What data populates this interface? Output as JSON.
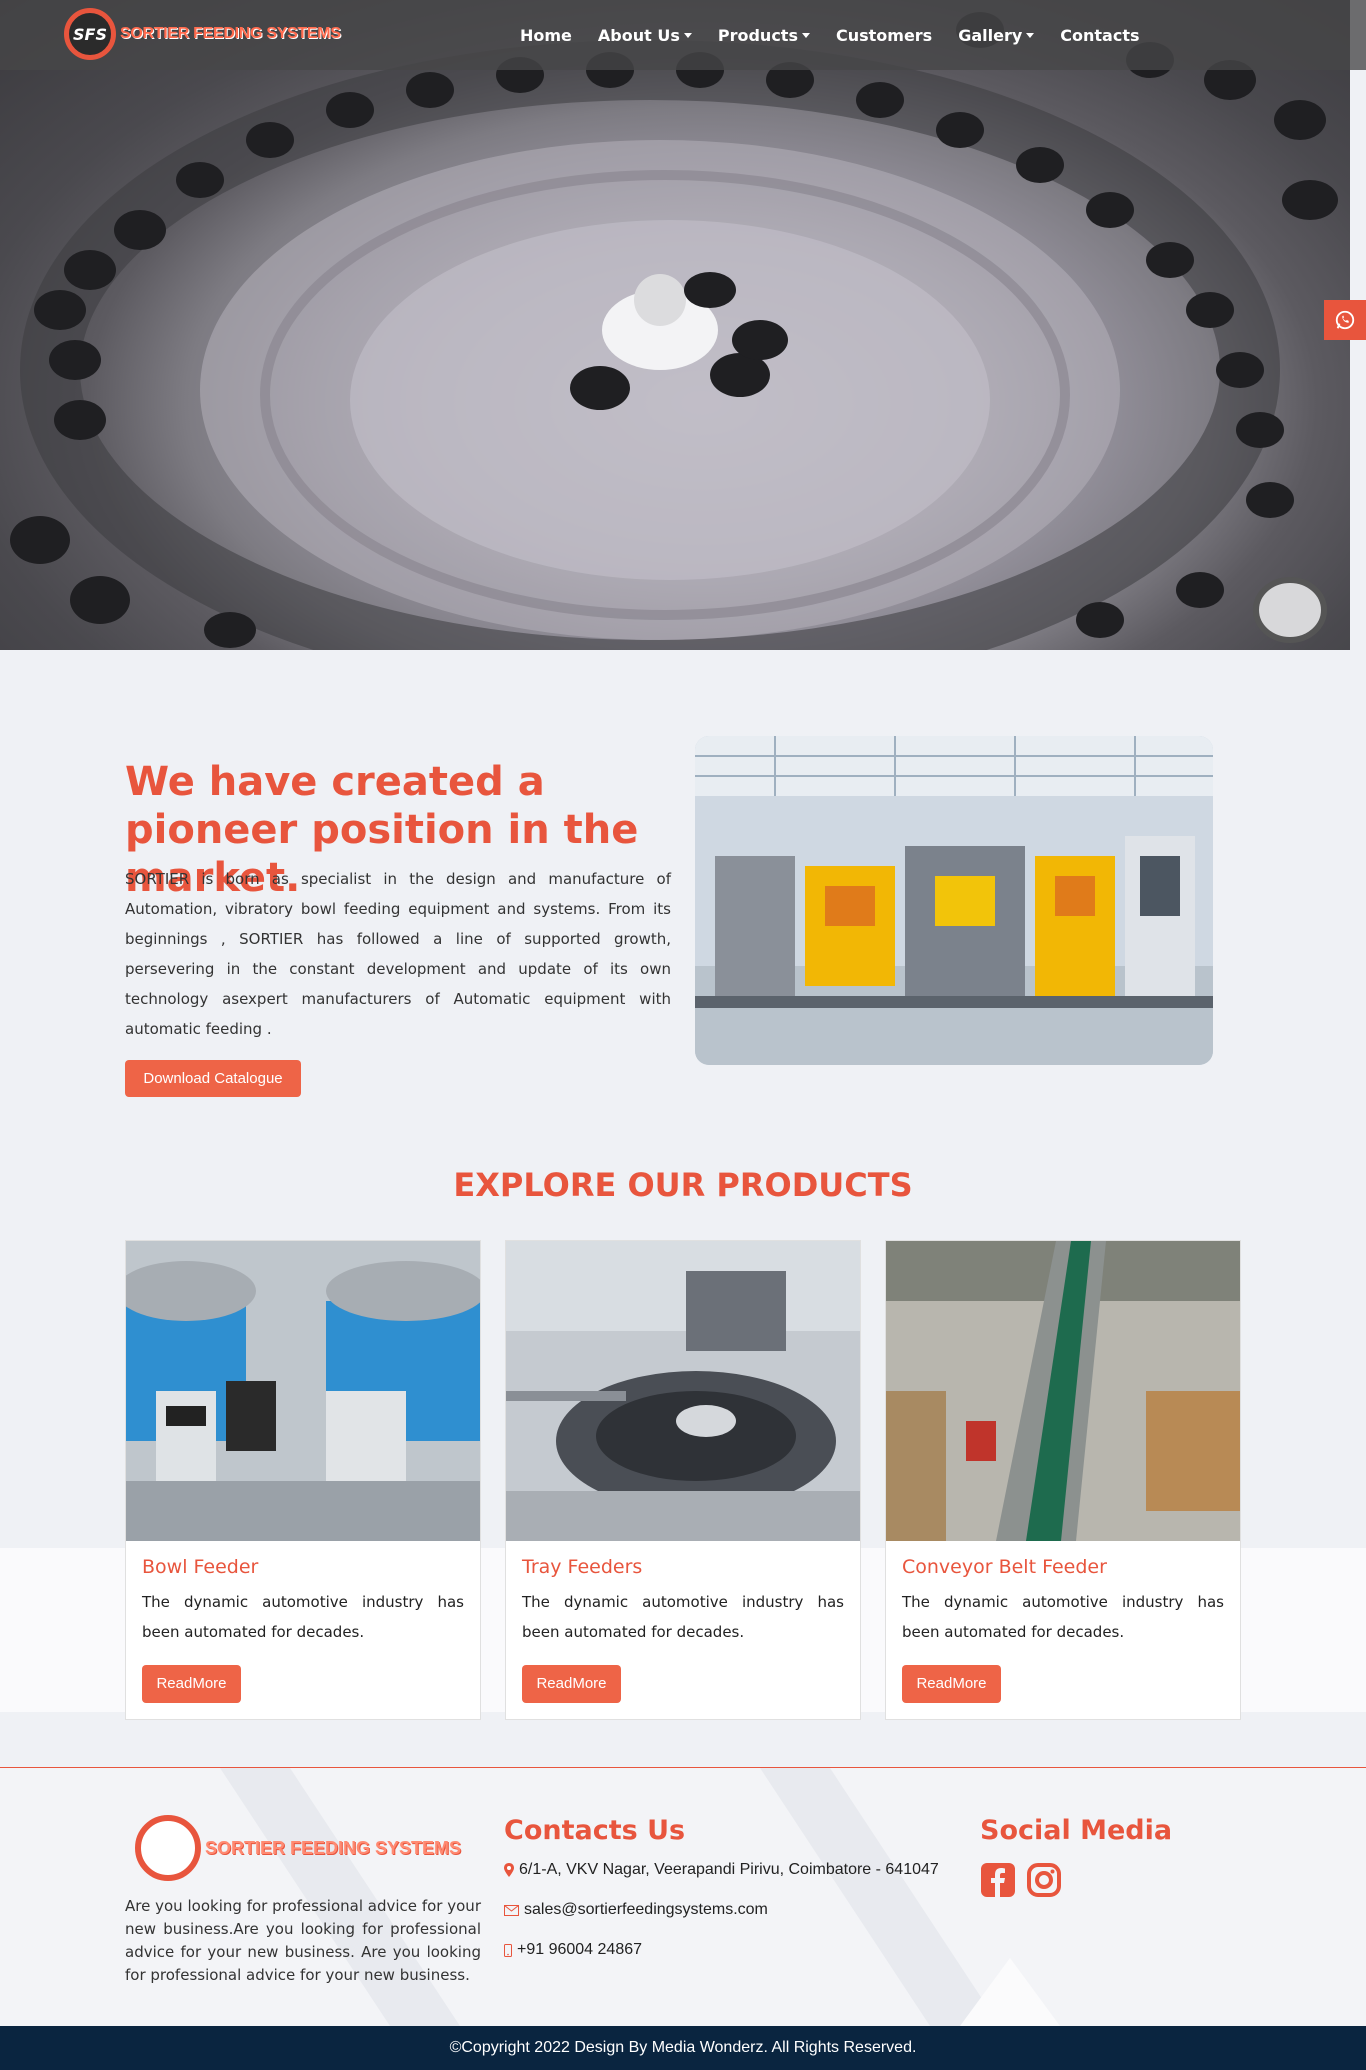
{
  "nav": {
    "logo_mark": "SFS",
    "logo_text": "SORTIER FEEDING SYSTEMS",
    "items": [
      {
        "label": "Home",
        "dropdown": false
      },
      {
        "label": "About Us",
        "dropdown": true
      },
      {
        "label": "Products",
        "dropdown": true
      },
      {
        "label": "Customers",
        "dropdown": false
      },
      {
        "label": "Gallery",
        "dropdown": true
      },
      {
        "label": "Contacts",
        "dropdown": false
      }
    ]
  },
  "about": {
    "title": "We have created a pioneer position in the market.",
    "text": "SORTIER is born as specialist in the design and manufacture of Automation, vibratory bowl feeding equipment and systems. From its beginnings , SORTIER has followed a line of supported growth, persevering in the constant development and update of its own technology asexpert manufacturers of Automatic equipment with automatic feeding .",
    "button": "Download Catalogue"
  },
  "products": {
    "title": "EXPLORE OUR PRODUCTS",
    "cards": [
      {
        "title": "Bowl Feeder",
        "text": "The dynamic automotive industry has been automated for decades.",
        "button": "ReadMore"
      },
      {
        "title": "Tray Feeders",
        "text": "The dynamic automotive industry has been automated for decades.",
        "button": "ReadMore"
      },
      {
        "title": "Conveyor Belt Feeder",
        "text": "The dynamic automotive industry has been automated for decades.",
        "button": "ReadMore"
      }
    ]
  },
  "footer": {
    "logo_text": "SORTIER FEEDING SYSTEMS",
    "about": "Are you looking for professional advice for your new business.Are you looking for professional advice for your new business. Are you looking for professional advice for your new business.",
    "contacts_title": "Contacts Us",
    "address": "6/1-A, VKV Nagar, Veerapandi Pirivu, Coimbatore - 641047",
    "email": "sales@sortierfeedingsystems.com",
    "phone": "+91 96004 24867",
    "social_title": "Social Media"
  },
  "copyright": "©Copyright 2022 Design By Media Wonderz. All Rights Reserved.",
  "colors": {
    "accent": "#e8553d",
    "footer_bar": "#0a2540"
  }
}
